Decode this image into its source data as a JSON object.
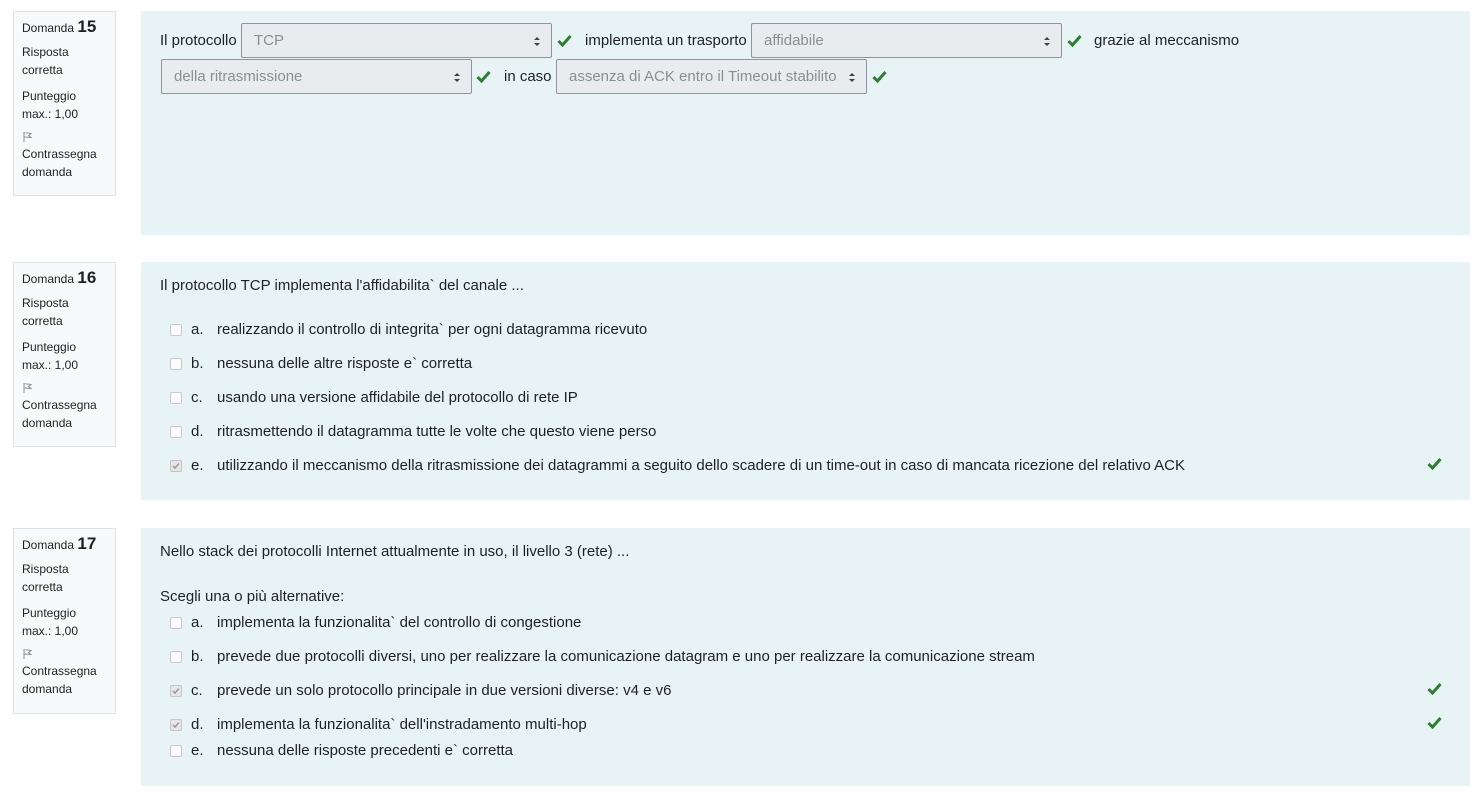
{
  "questions": [
    {
      "prefix": "Domanda",
      "number": "15",
      "state": "Risposta corretta",
      "grade": "Punteggio max.: 1,00",
      "flag": "Contrassegna domanda",
      "parts": {
        "t1": "Il protocollo",
        "s1": "TCP",
        "t2": "implementa un trasporto",
        "s2": "affidabile",
        "t3": "grazie al meccanismo",
        "s3": "della ritrasmissione",
        "t4": "in caso",
        "s4": "assenza di ACK entro il Timeout stabilito"
      }
    },
    {
      "prefix": "Domanda",
      "number": "16",
      "state": "Risposta corretta",
      "grade": "Punteggio max.: 1,00",
      "flag": "Contrassegna domanda",
      "text": "Il protocollo TCP implementa l'affidabilita` del canale ...",
      "options": [
        {
          "letter": "a.",
          "label": "realizzando il controllo di integrita` per ogni datagramma ricevuto",
          "checked": false
        },
        {
          "letter": "b.",
          "label": "nessuna delle altre risposte e` corretta",
          "checked": false
        },
        {
          "letter": "c.",
          "label": "usando una versione affidabile del protocollo di rete IP",
          "checked": false
        },
        {
          "letter": "d.",
          "label": "ritrasmettendo il datagramma tutte le volte che questo viene perso",
          "checked": false
        },
        {
          "letter": "e.",
          "label": "utilizzando il meccanismo della ritrasmissione dei datagrammi a seguito dello scadere di un time-out in caso di mancata ricezione del relativo ACK",
          "checked": true
        }
      ]
    },
    {
      "prefix": "Domanda",
      "number": "17",
      "state": "Risposta corretta",
      "grade": "Punteggio max.: 1,00",
      "flag": "Contrassegna domanda",
      "text": "Nello stack dei protocolli Internet attualmente in uso, il livello 3 (rete)  ...",
      "prompt": "Scegli una o più alternative:",
      "options": [
        {
          "letter": "a.",
          "label": "implementa la funzionalita` del controllo di congestione",
          "checked": false
        },
        {
          "letter": "b.",
          "label": "prevede due protocolli diversi, uno per realizzare la comunicazione datagram e uno per realizzare la comunicazione stream",
          "checked": false
        },
        {
          "letter": "c.",
          "label": "prevede un solo protocollo principale in due versioni diverse: v4 e v6",
          "checked": true
        },
        {
          "letter": "d.",
          "label": "implementa la funzionalita` dell'instradamento multi-hop",
          "checked": true
        },
        {
          "letter": "e.",
          "label": "nessuna delle risposte precedenti e` corretta",
          "checked": false
        }
      ]
    }
  ],
  "colors": {
    "check": "#2e7d32",
    "panel": "#e7f3f5",
    "info_bg": "#f8f9fa"
  },
  "icons": {
    "correct": "check-icon",
    "flag": "flag-icon",
    "select": "select-arrows-icon"
  }
}
